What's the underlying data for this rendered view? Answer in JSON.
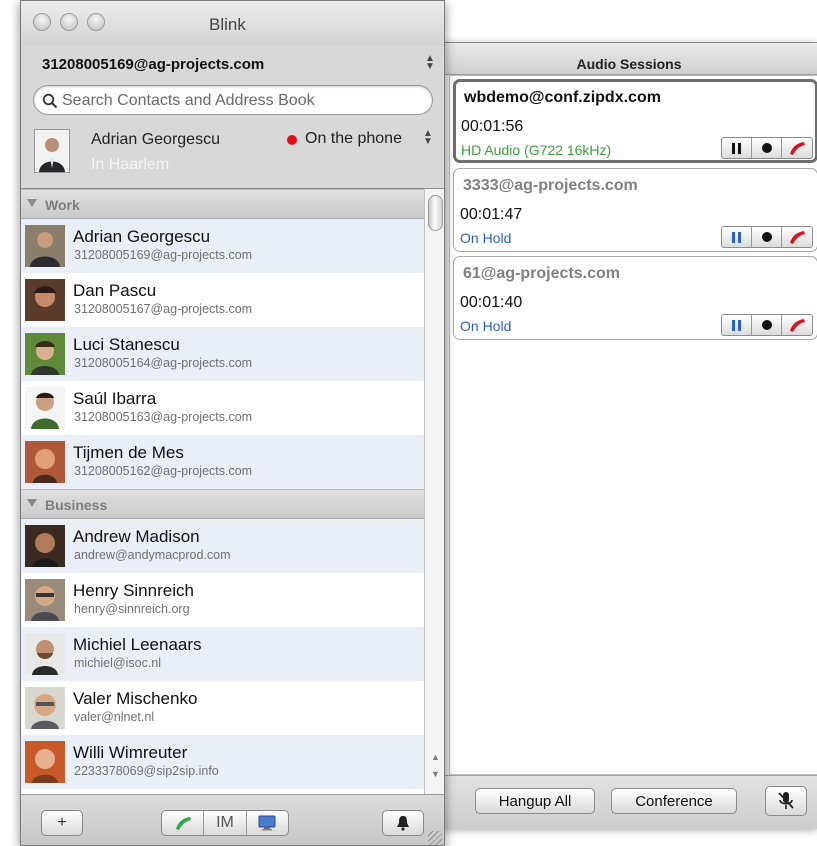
{
  "sessions_window": {
    "title": "Audio Sessions",
    "sessions": [
      {
        "address": "wbdemo@conf.zipdx.com",
        "duration": "00:01:56",
        "status": "HD Audio (G722 16kHz)",
        "active": true
      },
      {
        "address": "3333@ag-projects.com",
        "duration": "00:01:47",
        "status": "On Hold",
        "active": false
      },
      {
        "address": "61@ag-projects.com",
        "duration": "00:01:40",
        "status": "On Hold",
        "active": false
      }
    ],
    "hangup_all_label": "Hangup All",
    "conference_label": "Conference"
  },
  "blink": {
    "title": "Blink",
    "account": "31208005169@ag-projects.com",
    "search_placeholder": "Search Contacts and Address Book",
    "my_name": "Adrian Georgescu",
    "my_location": "In Haarlem",
    "my_status": "On the phone",
    "groups": [
      {
        "name": "Work",
        "contacts": [
          {
            "name": "Adrian Georgescu",
            "address": "31208005169@ag-projects.com"
          },
          {
            "name": "Dan Pascu",
            "address": "31208005167@ag-projects.com"
          },
          {
            "name": "Luci Stanescu",
            "address": "31208005164@ag-projects.com"
          },
          {
            "name": "Saúl Ibarra",
            "address": "31208005163@ag-projects.com"
          },
          {
            "name": "Tijmen de Mes",
            "address": "31208005162@ag-projects.com"
          }
        ]
      },
      {
        "name": "Business",
        "contacts": [
          {
            "name": "Andrew Madison",
            "address": "andrew@andymacprod.com"
          },
          {
            "name": "Henry Sinnreich",
            "address": "henry@sinnreich.org"
          },
          {
            "name": "Michiel Leenaars",
            "address": "michiel@isoc.nl"
          },
          {
            "name": "Valer Mischenko",
            "address": "valer@nlnet.nl"
          },
          {
            "name": "Willi Wimreuter",
            "address": "2233378069@sip2sip.info"
          }
        ]
      }
    ],
    "toolbar": {
      "add_label": "+",
      "im_label": "IM"
    }
  },
  "colors": {
    "hd_audio": "#3aa03a",
    "on_hold": "#2a5fbf",
    "hangup_red": "#d6141e",
    "phone_green": "#2aa84a",
    "status_dot": "#e0101a"
  }
}
